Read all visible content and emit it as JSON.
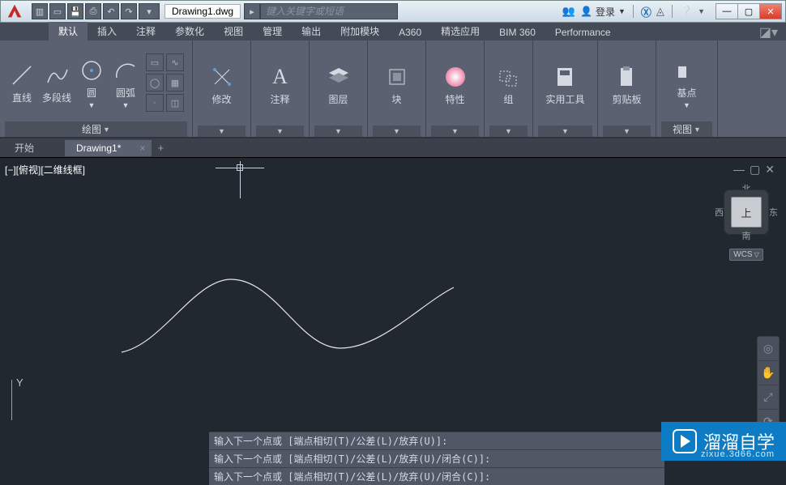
{
  "titlebar": {
    "doc_title": "Drawing1.dwg",
    "search_placeholder": "键入关键字或短语",
    "login_label": "登录"
  },
  "ribbon": {
    "tabs": [
      "默认",
      "插入",
      "注释",
      "参数化",
      "视图",
      "管理",
      "输出",
      "附加模块",
      "A360",
      "精选应用",
      "BIM 360",
      "Performance"
    ],
    "panels": {
      "draw": {
        "label": "绘图",
        "items": [
          "直线",
          "多段线",
          "圆",
          "圆弧"
        ]
      },
      "modify": {
        "label": "修改"
      },
      "annotate": {
        "label": "注释"
      },
      "layers": {
        "label": "图层"
      },
      "block": {
        "label": "块"
      },
      "properties": {
        "label": "特性"
      },
      "group": {
        "label": "组"
      },
      "utilities": {
        "label": "实用工具"
      },
      "clipboard": {
        "label": "剪贴板"
      },
      "view": {
        "label": "视图",
        "base": "基点"
      }
    }
  },
  "file_tabs": {
    "start": "开始",
    "current": "Drawing1*"
  },
  "viewport": {
    "label": "[−][俯视][二维线框]",
    "compass": {
      "n": "北",
      "s": "南",
      "e": "东",
      "w": "西",
      "top": "上",
      "wcs": "WCS"
    },
    "ucs_y": "Y"
  },
  "command": {
    "lines": [
      "输入下一个点或 [端点相切(T)/公差(L)/放弃(U)]:",
      "输入下一个点或 [端点相切(T)/公差(L)/放弃(U)/闭合(C)]:",
      "输入下一个点或 [端点相切(T)/公差(L)/放弃(U)/闭合(C)]:"
    ]
  },
  "watermark": {
    "title": "溜溜自学",
    "sub": "zixue.3d66.com"
  }
}
